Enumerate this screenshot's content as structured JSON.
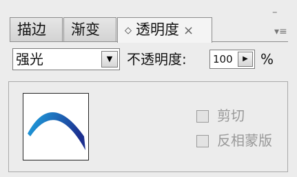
{
  "tabs": [
    {
      "label": "描边"
    },
    {
      "label": "渐变"
    },
    {
      "label": "透明度",
      "grip": "◇",
      "close": "×"
    }
  ],
  "panel_controls": {
    "minimize": "–",
    "menu": "▾≡"
  },
  "blend_mode": {
    "value": "强光",
    "arrow": "▼"
  },
  "opacity": {
    "label": "不透明度:",
    "value": "100",
    "stepper": "▶",
    "unit": "%"
  },
  "options": {
    "clip": {
      "label": "剪切",
      "checked": false
    },
    "invert_mask": {
      "label": "反相蒙版",
      "checked": false
    }
  },
  "colors": {
    "arc_start": "#1fa6e2",
    "arc_end": "#1c2f8f"
  }
}
